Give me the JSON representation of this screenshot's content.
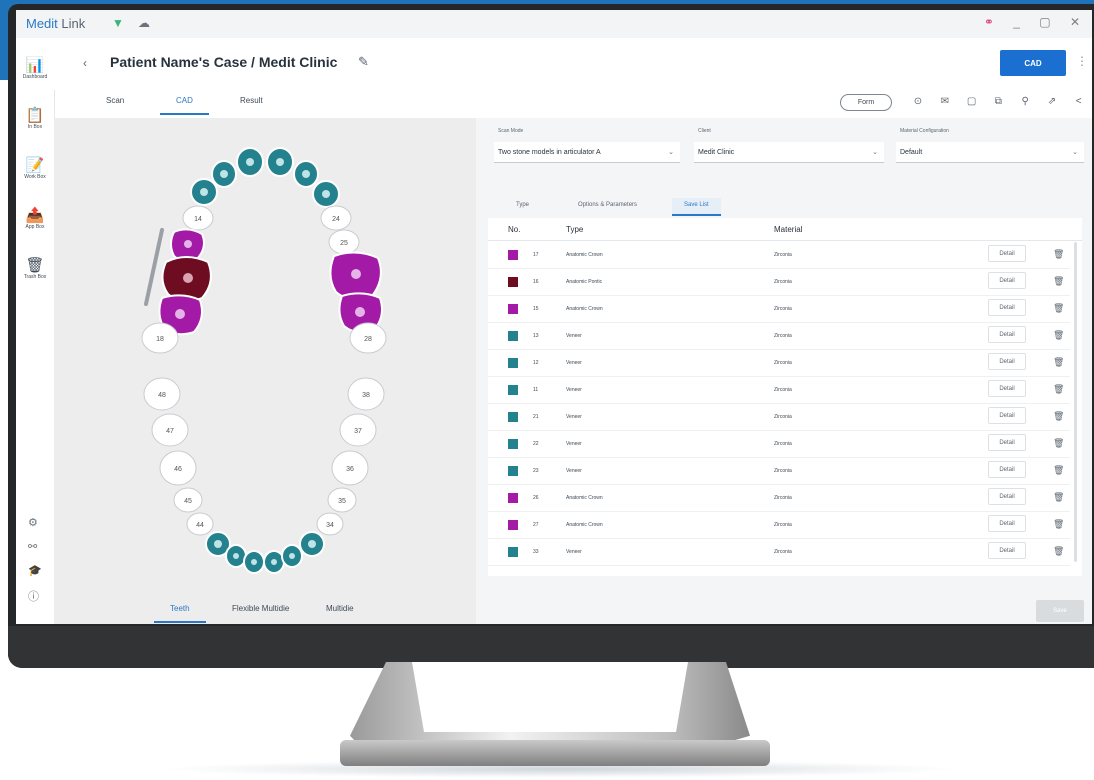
{
  "window": {
    "app_name_part1": "Medit",
    "app_name_part2": "Link",
    "wifi_icon": "▼",
    "cloud_icon": "☁",
    "link_icon": "⚭",
    "minimize": "_",
    "restore": "▢",
    "close": "✕"
  },
  "sidebar": {
    "items": [
      {
        "icon": "📊",
        "label": "Dashboard"
      },
      {
        "icon": "📋",
        "label": "In Box"
      },
      {
        "icon": "📝",
        "label": "Work Box"
      },
      {
        "icon": "📤",
        "label": "App Box"
      },
      {
        "icon": "🗑",
        "label": "Trash Box"
      }
    ],
    "bottom_icons": [
      "⚙",
      "⚯",
      "🎓",
      "ⓘ"
    ]
  },
  "header": {
    "back": "‹",
    "title": "Patient Name's Case / Medit Clinic",
    "edit_icon": "✎",
    "cad_button": "CAD",
    "more_icon": "⋮"
  },
  "tabs": [
    {
      "label": "Scan"
    },
    {
      "label": "CAD"
    },
    {
      "label": "Result"
    }
  ],
  "toolbar": {
    "form_button": "Form",
    "icons": [
      "⊙",
      "✉",
      "▢",
      "⧉",
      "⚲",
      "⇗",
      "<"
    ]
  },
  "teeth": {
    "labels": {
      "14": "14",
      "25": "25",
      "24": "24",
      "18": "18",
      "28": "28",
      "48": "48",
      "47": "47",
      "46": "46",
      "45": "45",
      "44": "44",
      "38": "38",
      "37": "37",
      "36": "36",
      "35": "35",
      "34": "34"
    }
  },
  "bottom_tabs": [
    {
      "label": "Teeth"
    },
    {
      "label": "Flexible Multidie"
    },
    {
      "label": "Multidie"
    }
  ],
  "form": {
    "scan_mode_label": "Scan Mode",
    "scan_mode_value": "Two stone models in articulator A",
    "client_label": "Client",
    "client_value": "Medit Clinic",
    "material_label": "Material Configuration",
    "material_value": "Default",
    "dropdown_icon": "⌄"
  },
  "subtabs": [
    {
      "label": "Type"
    },
    {
      "label": "Options & Parameters"
    },
    {
      "label": "Save List"
    }
  ],
  "list": {
    "headers": {
      "no": "No.",
      "type": "Type",
      "material": "Material"
    },
    "detail_label": "Detail",
    "delete_icon": "🗑",
    "rows": [
      {
        "no": "17",
        "type": "Anatomic Crown",
        "material": "Zirconia",
        "color": "#a21aa6"
      },
      {
        "no": "16",
        "type": "Anatomic Pontic",
        "material": "Zirconia",
        "color": "#6e0d22"
      },
      {
        "no": "15",
        "type": "Anatomic Crown",
        "material": "Zirconia",
        "color": "#a21aa6"
      },
      {
        "no": "13",
        "type": "Veneer",
        "material": "Zirconia",
        "color": "#23828d"
      },
      {
        "no": "12",
        "type": "Veneer",
        "material": "Zirconia",
        "color": "#23828d"
      },
      {
        "no": "11",
        "type": "Veneer",
        "material": "Zirconia",
        "color": "#23828d"
      },
      {
        "no": "21",
        "type": "Veneer",
        "material": "Zirconia",
        "color": "#23828d"
      },
      {
        "no": "22",
        "type": "Veneer",
        "material": "Zirconia",
        "color": "#23828d"
      },
      {
        "no": "23",
        "type": "Veneer",
        "material": "Zirconia",
        "color": "#23828d"
      },
      {
        "no": "26",
        "type": "Anatomic Crown",
        "material": "Zirconia",
        "color": "#a21aa6"
      },
      {
        "no": "27",
        "type": "Anatomic Crown",
        "material": "Zirconia",
        "color": "#a21aa6"
      },
      {
        "no": "33",
        "type": "Veneer",
        "material": "Zirconia",
        "color": "#23828d"
      }
    ]
  },
  "save_button": "Save",
  "colors": {
    "accent": "#1b6fd1",
    "veneer": "#23828d",
    "crown": "#a21aa6",
    "pontic": "#6e0d22"
  }
}
